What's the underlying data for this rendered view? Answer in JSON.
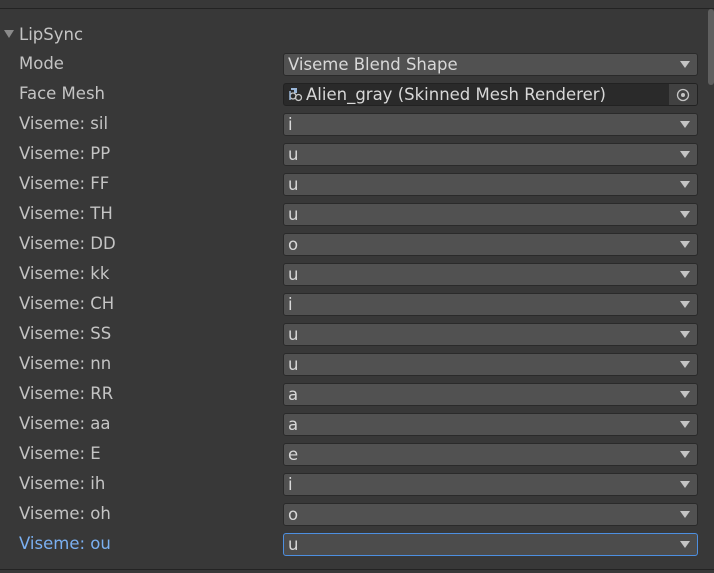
{
  "section": {
    "title": "LipSync",
    "expanded_icon": "foldout-expanded-arrow-icon"
  },
  "mode": {
    "label": "Mode",
    "value": "Viseme Blend Shape"
  },
  "face_mesh": {
    "label": "Face Mesh",
    "value": "Alien_gray (Skinned Mesh Renderer)",
    "icon": "skinned-mesh-renderer-icon",
    "picker_icon": "object-picker-icon"
  },
  "visemes": [
    {
      "label": "Viseme: sil",
      "value": "i"
    },
    {
      "label": "Viseme: PP",
      "value": "u"
    },
    {
      "label": "Viseme: FF",
      "value": "u"
    },
    {
      "label": "Viseme: TH",
      "value": "u"
    },
    {
      "label": "Viseme: DD",
      "value": "o"
    },
    {
      "label": "Viseme: kk",
      "value": "u"
    },
    {
      "label": "Viseme: CH",
      "value": "i"
    },
    {
      "label": "Viseme: SS",
      "value": "u"
    },
    {
      "label": "Viseme: nn",
      "value": "u"
    },
    {
      "label": "Viseme: RR",
      "value": "a"
    },
    {
      "label": "Viseme: aa",
      "value": "a"
    },
    {
      "label": "Viseme: E",
      "value": "e"
    },
    {
      "label": "Viseme: ih",
      "value": "i"
    },
    {
      "label": "Viseme: oh",
      "value": "o"
    },
    {
      "label": "Viseme: ou",
      "value": "u"
    }
  ],
  "colors": {
    "background": "#383838",
    "field": "#515151",
    "focus_border": "#4d8fe0",
    "focus_label": "#7bb0f1",
    "text": "#c4c4c4"
  }
}
